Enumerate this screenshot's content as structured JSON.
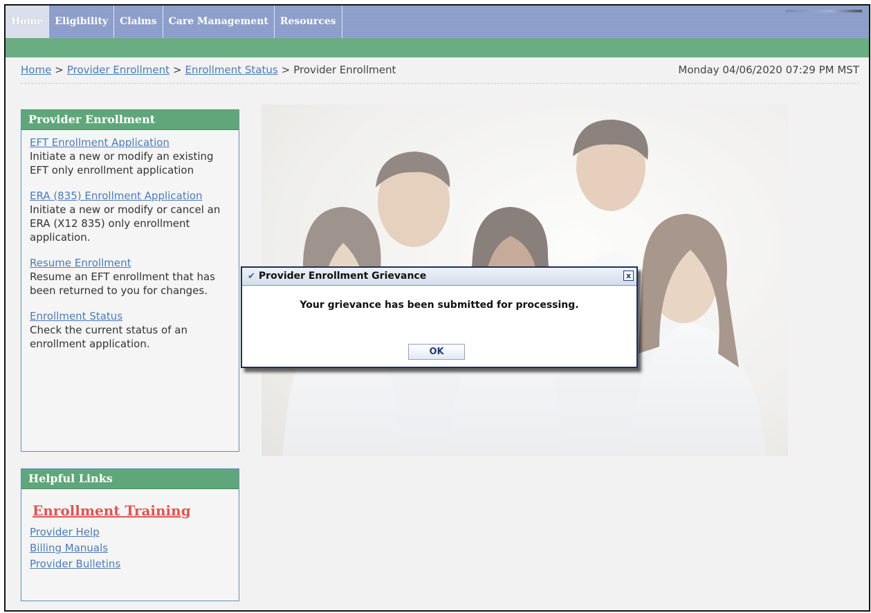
{
  "nav": {
    "tabs": [
      {
        "label": "Home"
      },
      {
        "label": "Eligibility"
      },
      {
        "label": "Claims"
      },
      {
        "label": "Care Management"
      },
      {
        "label": "Resources"
      }
    ]
  },
  "breadcrumb": {
    "items": [
      "Home",
      "Provider Enrollment",
      "Enrollment Status"
    ],
    "current": "Provider Enrollment",
    "separator": ">",
    "datetime": "Monday 04/06/2020 07:29 PM MST"
  },
  "provider_panel": {
    "title": "Provider Enrollment",
    "entries": [
      {
        "link": "EFT Enrollment Application",
        "desc": "Initiate a new or modify an existing EFT only enrollment application"
      },
      {
        "link": "ERA (835) Enrollment Application",
        "desc": "Initiate a new or modify or cancel an ERA (X12 835) only enrollment application."
      },
      {
        "link": "Resume Enrollment",
        "desc": "Resume an EFT enrollment that has been returned to you for changes."
      },
      {
        "link": "Enrollment Status",
        "desc": "Check the current status of an enrollment application."
      }
    ]
  },
  "helpful_links": {
    "title": "Helpful Links",
    "training": "Enrollment Training",
    "links": [
      "Provider Help",
      "Billing Manuals",
      "Provider Bulletins"
    ]
  },
  "dialog": {
    "title": "Provider Enrollment Grievance",
    "close_label": "x",
    "message": "Your grievance has been submitted for processing.",
    "ok_label": "OK"
  },
  "colors": {
    "nav_bg": "#8a9cc8",
    "green_bar": "#6aad83",
    "link": "#4a7bb8",
    "training": "#e0554f",
    "panel_border": "#5d8fb8"
  }
}
